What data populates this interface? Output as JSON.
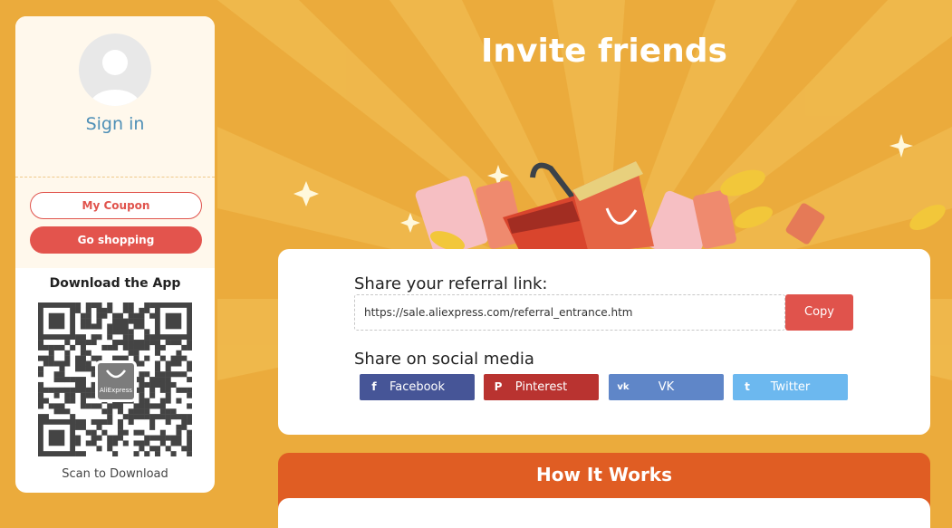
{
  "sidebar": {
    "sign_in": "Sign in",
    "my_coupon": "My Coupon",
    "go_shopping": "Go shopping",
    "download_title": "Download the App",
    "qr_logo_text": "AliExpress",
    "scan_text": "Scan to Download"
  },
  "hero": {
    "title": "Invite friends"
  },
  "share": {
    "referral_label": "Share your referral link:",
    "referral_link": "https://sale.aliexpress.com/referral_entrance.htm",
    "copy_label": "Copy",
    "social_label": "Share on social media",
    "social": [
      {
        "name": "Facebook",
        "icon": "f",
        "color": "#465597"
      },
      {
        "name": "Pinterest",
        "icon": "P",
        "color": "#b93330"
      },
      {
        "name": "VK",
        "icon": "vk",
        "color": "#5f86c8"
      },
      {
        "name": "Twitter",
        "icon": "t",
        "color": "#6cb8ef"
      }
    ]
  },
  "how_it_works": {
    "title": "How It Works"
  },
  "colors": {
    "background": "#ebab3c",
    "accent": "#e0534c",
    "how_header": "#e05d23",
    "link": "#4e8fb6"
  }
}
